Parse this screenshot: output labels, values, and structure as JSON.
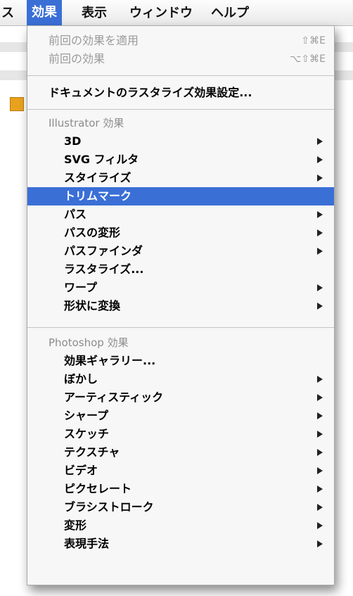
{
  "menubar": {
    "items": [
      {
        "label": "ス"
      },
      {
        "label": "効果"
      },
      {
        "label": "表示"
      },
      {
        "label": "ウィンドウ"
      },
      {
        "label": "ヘルプ"
      }
    ]
  },
  "menu": {
    "recent": [
      {
        "label": "前回の効果を適用",
        "shortcut": "⇧⌘E"
      },
      {
        "label": "前回の効果",
        "shortcut": "⌥⇧⌘E"
      }
    ],
    "document_raster_settings": "ドキュメントのラスタライズ効果設定...",
    "illustrator_header": "Illustrator 効果",
    "illustrator_items": [
      {
        "label": "3D",
        "submenu": true
      },
      {
        "label": "SVG フィルタ",
        "submenu": true
      },
      {
        "label": "スタイライズ",
        "submenu": true
      },
      {
        "label": "トリムマーク",
        "submenu": false,
        "selected": true
      },
      {
        "label": "パス",
        "submenu": true
      },
      {
        "label": "パスの変形",
        "submenu": true
      },
      {
        "label": "パスファインダ",
        "submenu": true
      },
      {
        "label": "ラスタライズ...",
        "submenu": false
      },
      {
        "label": "ワープ",
        "submenu": true
      },
      {
        "label": "形状に変換",
        "submenu": true
      }
    ],
    "photoshop_header": "Photoshop 効果",
    "photoshop_items": [
      {
        "label": "効果ギャラリー...",
        "submenu": false
      },
      {
        "label": "ぼかし",
        "submenu": true
      },
      {
        "label": "アーティスティック",
        "submenu": true
      },
      {
        "label": "シャープ",
        "submenu": true
      },
      {
        "label": "スケッチ",
        "submenu": true
      },
      {
        "label": "テクスチャ",
        "submenu": true
      },
      {
        "label": "ビデオ",
        "submenu": true
      },
      {
        "label": "ピクセレート",
        "submenu": true
      },
      {
        "label": "ブラシストローク",
        "submenu": true
      },
      {
        "label": "変形",
        "submenu": true
      },
      {
        "label": "表現手法",
        "submenu": true
      }
    ]
  },
  "colors": {
    "highlight": "#3a6fd6",
    "menu_background": "#f7f7f7",
    "disabled_text": "#9a9a9a"
  }
}
